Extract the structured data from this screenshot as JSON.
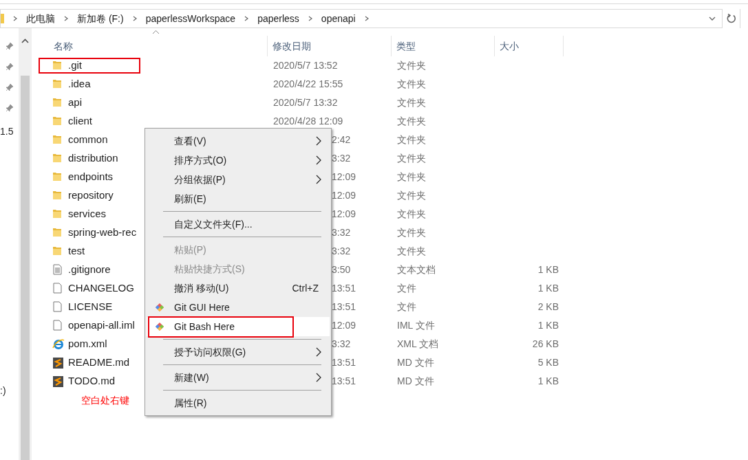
{
  "breadcrumb": [
    "此电脑",
    "新加卷 (F:)",
    "paperlessWorkspace",
    "paperless",
    "openapi"
  ],
  "nav_pane": {
    "texts": [
      "1.5",
      ":)"
    ]
  },
  "columns": [
    "名称",
    "修改日期",
    "类型",
    "大小"
  ],
  "rows": [
    {
      "kind": "folder",
      "name": ".git",
      "date": "2020/5/7 13:52",
      "type": "文件夹",
      "highlighted": true,
      "covered": false
    },
    {
      "kind": "folder",
      "name": ".idea",
      "date": "2020/4/22 15:55",
      "type": "文件夹",
      "highlighted": false,
      "covered": false
    },
    {
      "kind": "folder",
      "name": "api",
      "date": "2020/5/7 13:32",
      "type": "文件夹",
      "highlighted": false,
      "covered": false
    },
    {
      "kind": "folder",
      "name": "client",
      "date": "2020/4/28 12:09",
      "type": "文件夹",
      "highlighted": false,
      "covered": false
    },
    {
      "kind": "folder",
      "name": "common",
      "date": "2:42",
      "type": "文件夹",
      "highlighted": false,
      "covered": true
    },
    {
      "kind": "folder",
      "name": "distribution",
      "date": "3:32",
      "type": "文件夹",
      "highlighted": false,
      "covered": true
    },
    {
      "kind": "folder",
      "name": "endpoints",
      "date": "12:09",
      "type": "文件夹",
      "highlighted": false,
      "covered": true
    },
    {
      "kind": "folder",
      "name": "repository",
      "date": "12:09",
      "type": "文件夹",
      "highlighted": false,
      "covered": true
    },
    {
      "kind": "folder",
      "name": "services",
      "date": "12:09",
      "type": "文件夹",
      "highlighted": false,
      "covered": true
    },
    {
      "kind": "folder",
      "name": "spring-web-rec",
      "date": "3:32",
      "type": "文件夹",
      "highlighted": false,
      "covered": true
    },
    {
      "kind": "folder",
      "name": "test",
      "date": "3:32",
      "type": "文件夹",
      "highlighted": false,
      "covered": true
    },
    {
      "kind": "text",
      "name": ".gitignore",
      "date": "3:50",
      "type": "文本文档",
      "size": "1 KB",
      "highlighted": false,
      "covered": true
    },
    {
      "kind": "file",
      "name": "CHANGELOG",
      "date": "13:51",
      "type": "文件",
      "size": "1 KB",
      "highlighted": false,
      "covered": true
    },
    {
      "kind": "file",
      "name": "LICENSE",
      "date": "13:51",
      "type": "文件",
      "size": "2 KB",
      "highlighted": false,
      "covered": true
    },
    {
      "kind": "file",
      "name": "openapi-all.iml",
      "date": "12:09",
      "type": "IML 文件",
      "size": "1 KB",
      "highlighted": false,
      "covered": true
    },
    {
      "kind": "browser",
      "name": "pom.xml",
      "date": "3:32",
      "type": "XML 文档",
      "size": "26 KB",
      "highlighted": false,
      "covered": true
    },
    {
      "kind": "editor",
      "name": "README.md",
      "date": "13:51",
      "type": "MD 文件",
      "size": "5 KB",
      "highlighted": false,
      "covered": true
    },
    {
      "kind": "editor",
      "name": "TODO.md",
      "date": "13:51",
      "type": "MD 文件",
      "size": "1 KB",
      "highlighted": false,
      "covered": true
    }
  ],
  "annotation": "空白处右键",
  "context_menu": [
    {
      "kind": "item",
      "label": "查看(V)",
      "submenu": true,
      "disabled": false,
      "selected": false,
      "highlighted": false
    },
    {
      "kind": "item",
      "label": "排序方式(O)",
      "submenu": true,
      "disabled": false,
      "selected": false,
      "highlighted": false
    },
    {
      "kind": "item",
      "label": "分组依据(P)",
      "submenu": true,
      "disabled": false,
      "selected": false,
      "highlighted": false
    },
    {
      "kind": "item",
      "label": "刷新(E)",
      "submenu": false,
      "disabled": false,
      "selected": false,
      "highlighted": false
    },
    {
      "kind": "separator"
    },
    {
      "kind": "item",
      "label": "自定义文件夹(F)...",
      "submenu": false,
      "disabled": false,
      "selected": false,
      "highlighted": false
    },
    {
      "kind": "separator"
    },
    {
      "kind": "item",
      "label": "粘贴(P)",
      "submenu": false,
      "disabled": true,
      "selected": false,
      "highlighted": false
    },
    {
      "kind": "item",
      "label": "粘贴快捷方式(S)",
      "submenu": false,
      "disabled": true,
      "selected": false,
      "highlighted": false
    },
    {
      "kind": "item",
      "label": "撤消 移动(U)",
      "shortcut": "Ctrl+Z",
      "submenu": false,
      "disabled": false,
      "selected": false,
      "highlighted": false
    },
    {
      "kind": "git",
      "label": "Git GUI Here",
      "submenu": false,
      "disabled": false,
      "selected": false,
      "highlighted": false
    },
    {
      "kind": "git",
      "label": "Git Bash Here",
      "submenu": false,
      "disabled": false,
      "selected": true,
      "highlighted": true
    },
    {
      "kind": "separator"
    },
    {
      "kind": "item",
      "label": "授予访问权限(G)",
      "submenu": true,
      "disabled": false,
      "selected": false,
      "highlighted": false
    },
    {
      "kind": "separator"
    },
    {
      "kind": "item",
      "label": "新建(W)",
      "submenu": true,
      "disabled": false,
      "selected": false,
      "highlighted": false
    },
    {
      "kind": "separator"
    },
    {
      "kind": "item",
      "label": "属性(R)",
      "submenu": false,
      "disabled": false,
      "selected": false,
      "highlighted": false
    }
  ]
}
